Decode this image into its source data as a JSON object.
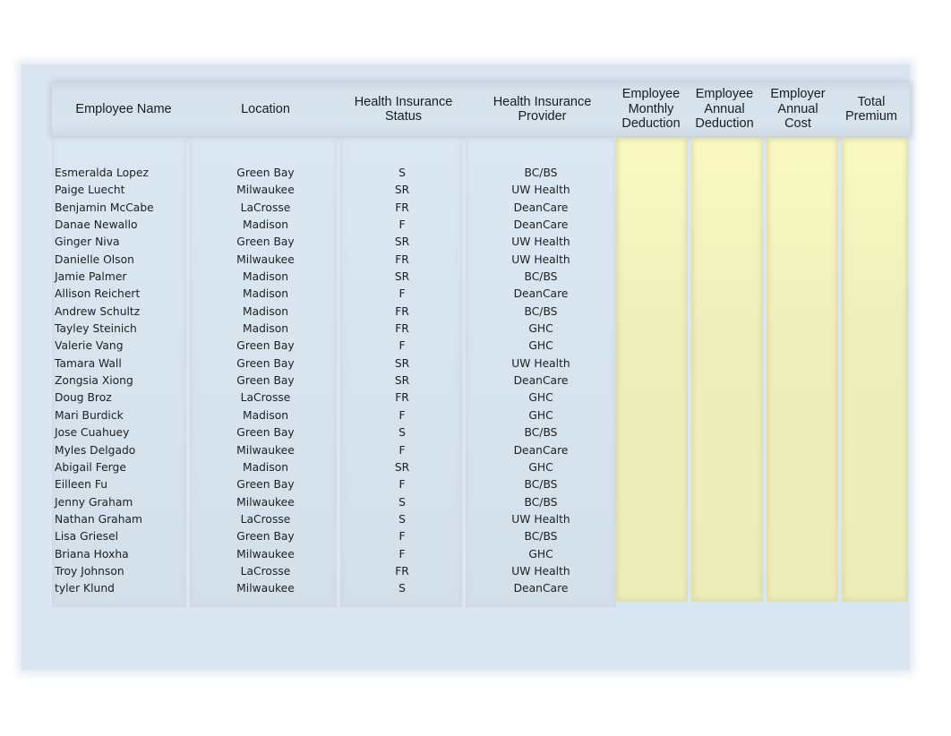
{
  "table": {
    "headers": [
      "Employee Name",
      "Location",
      "Health Insurance\nStatus",
      "Health Insurance\nProvider",
      "Employee\nMonthly\nDeduction",
      "Employee\nAnnual\nDeduction",
      "Employer\nAnnual\nCost",
      "Total\nPremium"
    ],
    "rows": [
      {
        "name": "Esmeralda Lopez",
        "location": "Green Bay",
        "status": "S",
        "provider": "BC/BS"
      },
      {
        "name": "Paige Luecht",
        "location": "Milwaukee",
        "status": "SR",
        "provider": "UW Health"
      },
      {
        "name": "Benjamin McCabe",
        "location": "LaCrosse",
        "status": "FR",
        "provider": "DeanCare"
      },
      {
        "name": "Danae Newallo",
        "location": "Madison",
        "status": "F",
        "provider": "DeanCare"
      },
      {
        "name": "Ginger Niva",
        "location": "Green Bay",
        "status": "SR",
        "provider": "UW Health"
      },
      {
        "name": "Danielle Olson",
        "location": "Milwaukee",
        "status": "FR",
        "provider": "UW Health"
      },
      {
        "name": "Jamie Palmer",
        "location": "Madison",
        "status": "SR",
        "provider": "BC/BS"
      },
      {
        "name": "Allison Reichert",
        "location": "Madison",
        "status": "F",
        "provider": "DeanCare"
      },
      {
        "name": "Andrew Schultz",
        "location": "Madison",
        "status": "FR",
        "provider": "BC/BS"
      },
      {
        "name": "Tayley Steinich",
        "location": "Madison",
        "status": "FR",
        "provider": "GHC"
      },
      {
        "name": "Valerie Vang",
        "location": "Green Bay",
        "status": "F",
        "provider": "GHC"
      },
      {
        "name": "Tamara Wall",
        "location": "Green Bay",
        "status": "SR",
        "provider": "UW Health"
      },
      {
        "name": "Zongsia Xiong",
        "location": "Green Bay",
        "status": "SR",
        "provider": "DeanCare"
      },
      {
        "name": "Doug Broz",
        "location": "LaCrosse",
        "status": "FR",
        "provider": "GHC"
      },
      {
        "name": "Mari Burdick",
        "location": "Madison",
        "status": "F",
        "provider": "GHC"
      },
      {
        "name": "Jose Cuahuey",
        "location": "Green Bay",
        "status": "S",
        "provider": "BC/BS"
      },
      {
        "name": "Myles Delgado",
        "location": "Milwaukee",
        "status": "F",
        "provider": "DeanCare"
      },
      {
        "name": "Abigail Ferge",
        "location": "Madison",
        "status": "SR",
        "provider": "GHC"
      },
      {
        "name": "Eilleen Fu",
        "location": "Green Bay",
        "status": "F",
        "provider": "BC/BS"
      },
      {
        "name": "Jenny Graham",
        "location": "Milwaukee",
        "status": "S",
        "provider": "BC/BS"
      },
      {
        "name": "Nathan Graham",
        "location": "LaCrosse",
        "status": "S",
        "provider": "UW Health"
      },
      {
        "name": "Lisa Griesel",
        "location": "Green Bay",
        "status": "F",
        "provider": "BC/BS"
      },
      {
        "name": "Briana Hoxha",
        "location": "Milwaukee",
        "status": "F",
        "provider": "GHC"
      },
      {
        "name": "Troy Johnson",
        "location": "LaCrosse",
        "status": "FR",
        "provider": "UW Health"
      },
      {
        "name": "tyler Klund",
        "location": "Milwaukee",
        "status": "S",
        "provider": "DeanCare"
      }
    ]
  },
  "colors": {
    "sheet_background": "#dae6f1",
    "header_background": "#d6e2ec",
    "input_column_fill": "#eeefbc"
  }
}
